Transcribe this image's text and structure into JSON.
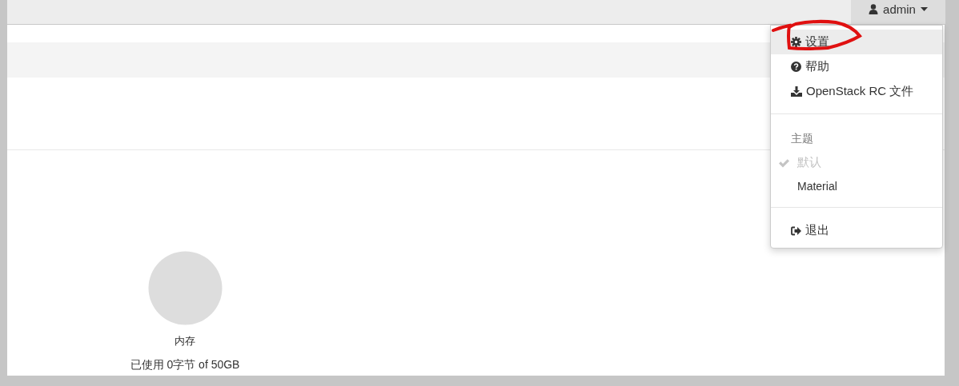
{
  "user_menu": {
    "label": "admin",
    "items": [
      {
        "kind": "link",
        "label": "设置",
        "highlighted": true
      },
      {
        "kind": "link",
        "label": "帮助",
        "highlighted": false
      },
      {
        "kind": "link",
        "label": "OpenStack RC 文件",
        "highlighted": false
      },
      {
        "kind": "divider"
      },
      {
        "kind": "header",
        "label": "主题"
      },
      {
        "kind": "theme",
        "label": "默认",
        "selected": true
      },
      {
        "kind": "theme",
        "label": "Material",
        "selected": false
      },
      {
        "kind": "divider"
      },
      {
        "kind": "link",
        "label": "退出",
        "highlighted": false
      }
    ]
  },
  "memory_usage": {
    "label": "内存",
    "used_text": "已使用 0字节 of 50GB"
  }
}
